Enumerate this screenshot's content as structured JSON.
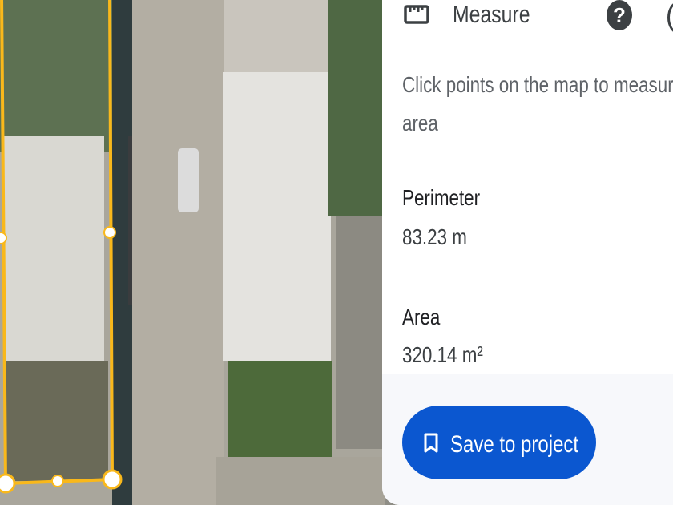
{
  "panel": {
    "title": "Measure",
    "title_icon": "ruler-icon",
    "help_icon": "help-icon",
    "description_line1": "Click points on the map to measure",
    "description_line2": "area",
    "perimeter_label": "Perimeter",
    "perimeter_value": "83.23 m",
    "area_label": "Area",
    "area_value": "320.14 m²",
    "save_button_label": "Save to project",
    "save_icon": "bookmark-icon"
  },
  "colors": {
    "accent": "#0b57d0",
    "polygon": "#f9b81b"
  }
}
